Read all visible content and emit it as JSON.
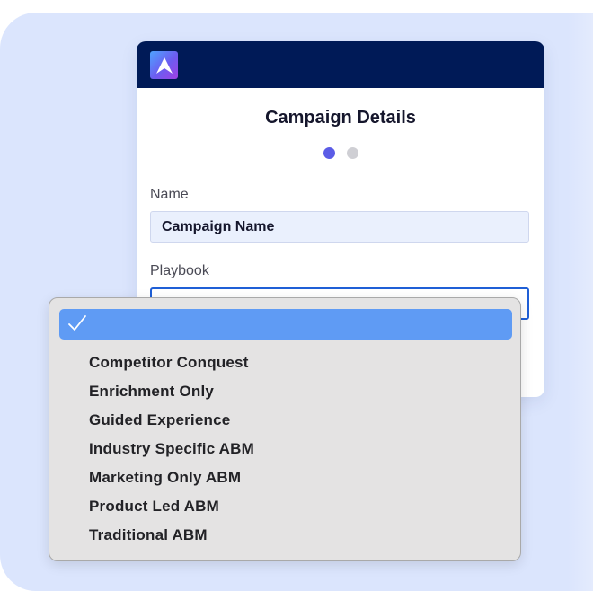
{
  "card": {
    "title": "Campaign Details",
    "steps": [
      "active",
      "inactive"
    ],
    "name_label": "Name",
    "name_value": "Campaign Name",
    "playbook_label": "Playbook"
  },
  "dropdown": {
    "selected_value": "",
    "options": [
      "Competitor Conquest",
      "Enrichment Only",
      "Guided Experience",
      "Industry Specific ABM",
      "Marketing Only ABM",
      "Product Led ABM",
      "Traditional ABM"
    ]
  },
  "colors": {
    "header": "#001a57",
    "active_dot": "#5b5ce6",
    "selected_option": "#5f9bf4",
    "focus_border": "#1f5fd6"
  }
}
